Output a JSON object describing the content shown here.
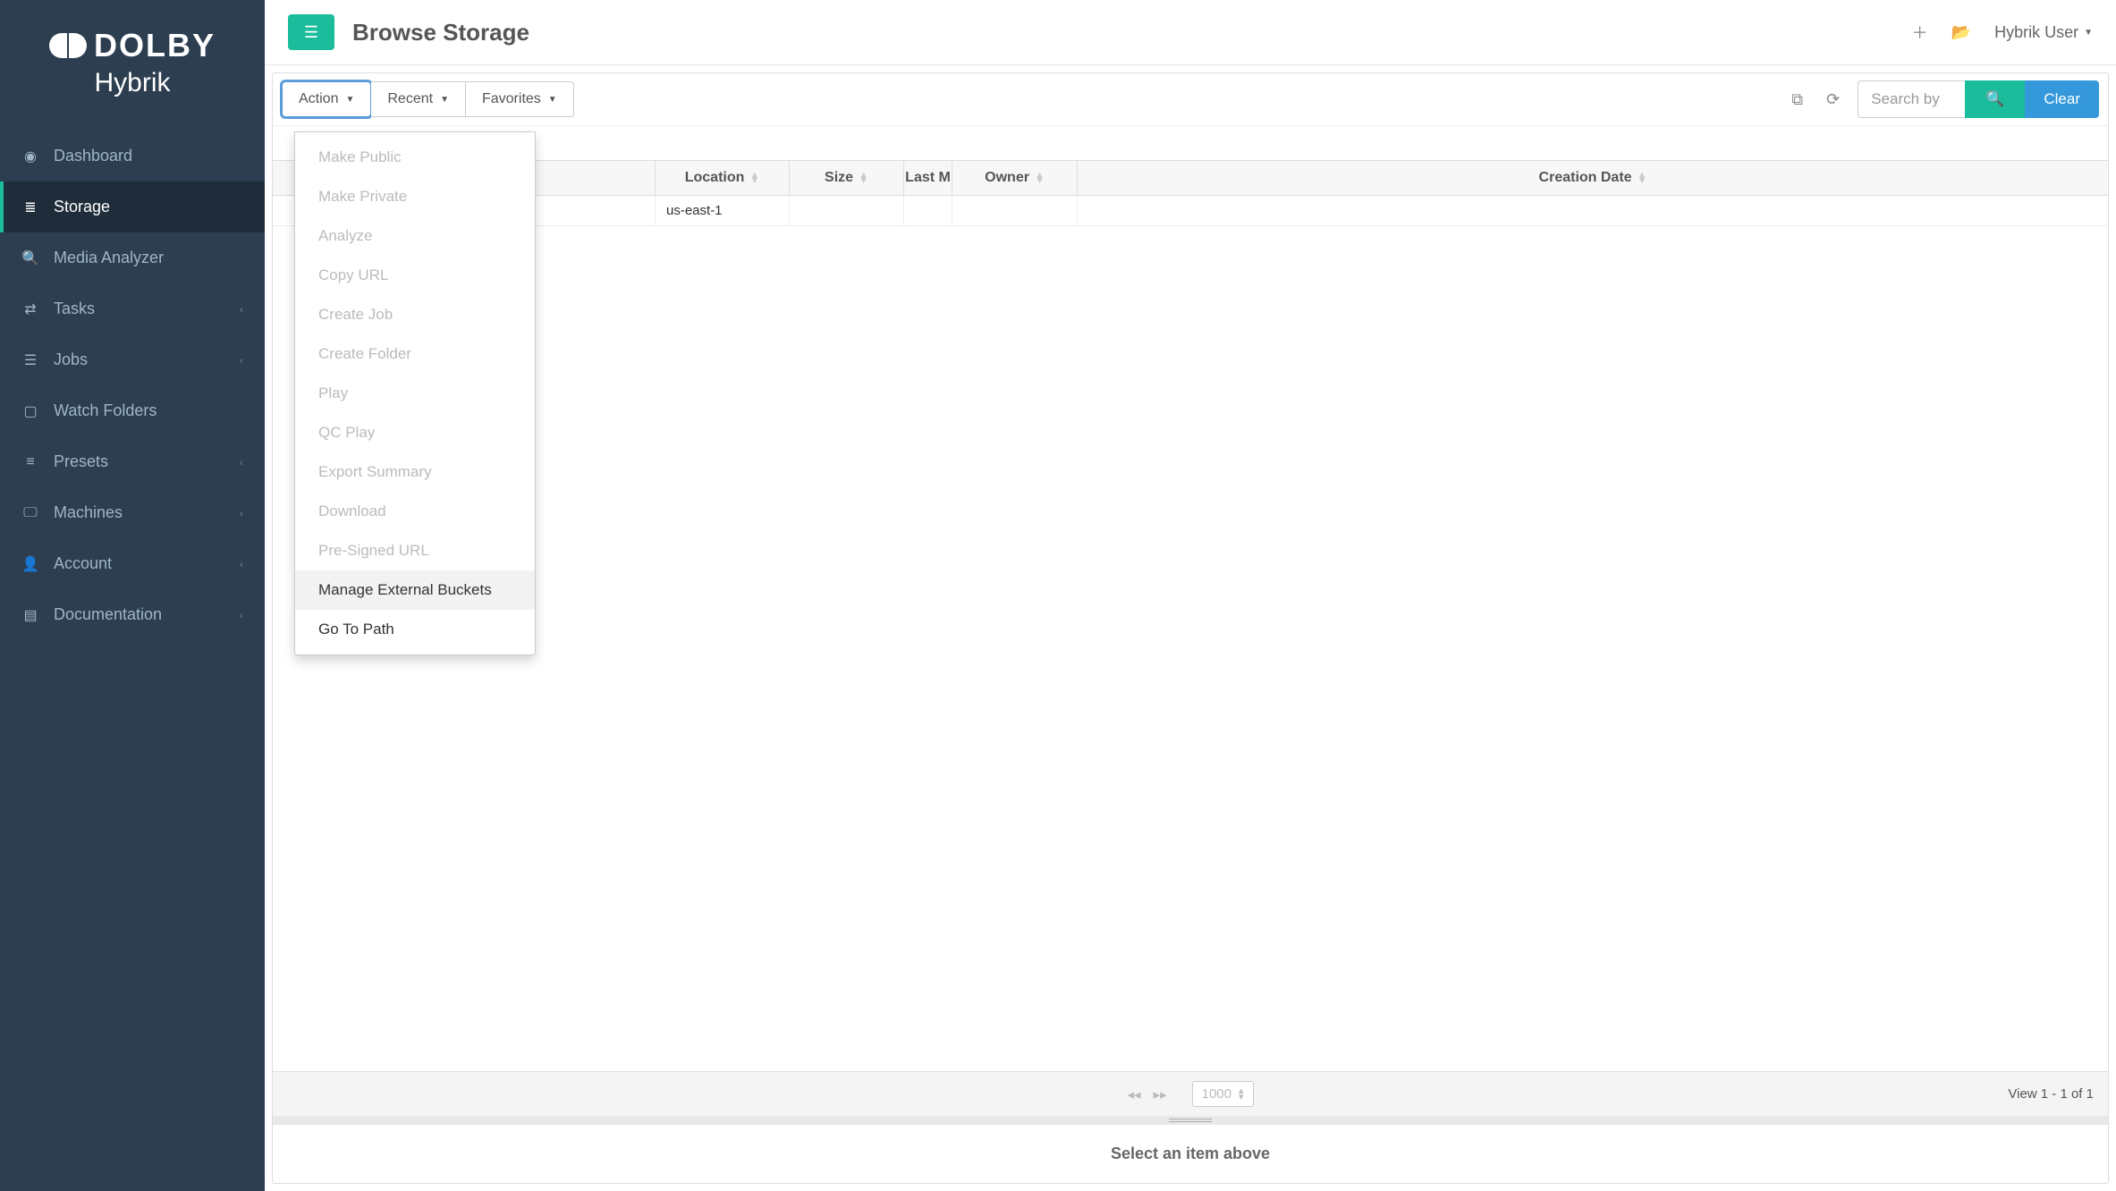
{
  "brand": {
    "dolby": "DOLBY",
    "hybrik": "Hybrik"
  },
  "sidebar": {
    "items": [
      {
        "label": "Dashboard",
        "icon": "◉",
        "chevron": false
      },
      {
        "label": "Storage",
        "icon": "≣",
        "chevron": false,
        "active": true
      },
      {
        "label": "Media Analyzer",
        "icon": "🔍",
        "chevron": false
      },
      {
        "label": "Tasks",
        "icon": "⇄",
        "chevron": true
      },
      {
        "label": "Jobs",
        "icon": "☰",
        "chevron": true
      },
      {
        "label": "Watch Folders",
        "icon": "▢",
        "chevron": false
      },
      {
        "label": "Presets",
        "icon": "≡",
        "chevron": true
      },
      {
        "label": "Machines",
        "icon": "🖵",
        "chevron": true
      },
      {
        "label": "Account",
        "icon": "👤",
        "chevron": true
      },
      {
        "label": "Documentation",
        "icon": "▤",
        "chevron": true
      }
    ]
  },
  "header": {
    "title": "Browse Storage",
    "user": "Hybrik User"
  },
  "toolbar": {
    "action": "Action",
    "recent": "Recent",
    "favorites": "Favorites",
    "search_placeholder": "Search by",
    "clear": "Clear"
  },
  "action_menu": [
    {
      "label": "Make Public",
      "enabled": false
    },
    {
      "label": "Make Private",
      "enabled": false
    },
    {
      "label": "Analyze",
      "enabled": false
    },
    {
      "label": "Copy URL",
      "enabled": false
    },
    {
      "label": "Create Job",
      "enabled": false
    },
    {
      "label": "Create Folder",
      "enabled": false
    },
    {
      "label": "Play",
      "enabled": false
    },
    {
      "label": "QC Play",
      "enabled": false
    },
    {
      "label": "Export Summary",
      "enabled": false
    },
    {
      "label": "Download",
      "enabled": false
    },
    {
      "label": "Pre-Signed URL",
      "enabled": false
    },
    {
      "label": "Manage External Buckets",
      "enabled": true,
      "hover": true
    },
    {
      "label": "Go To Path",
      "enabled": true
    }
  ],
  "table": {
    "columns": {
      "location": "Location",
      "size": "Size",
      "last_modified": "Last M",
      "owner": "Owner",
      "creation_date": "Creation Date"
    },
    "rows": [
      {
        "location": "us-east-1"
      }
    ]
  },
  "pager": {
    "page_size": "1000",
    "info": "View 1 - 1 of 1"
  },
  "detail": {
    "empty_msg": "Select an item above"
  }
}
